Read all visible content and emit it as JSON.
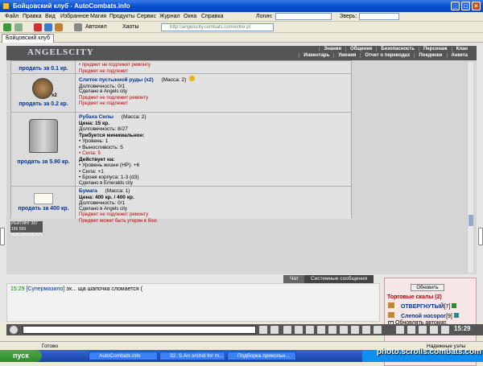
{
  "window": {
    "title": "Бойцовский клуб - AutoCombats.info"
  },
  "menu": [
    "Файл",
    "Правка",
    "Вид",
    "Избранное",
    "Магия",
    "Продукты",
    "Сервис",
    "Журнал",
    "Окна",
    "Справка"
  ],
  "toolbar": {
    "login_label": "Логин:",
    "beast_label": "Зверь:",
    "autoheal": "Автохил",
    "chaos": "Хаоты",
    "address": "http://angelscity.combats.com/enter.pl"
  },
  "tab": {
    "label": "Бойцовский клуб"
  },
  "game": {
    "logo": "ANGELSCITY",
    "nav_top": [
      "Знания",
      "Общение",
      "Безопасность",
      "Персонаж",
      "Клан"
    ],
    "nav_bottom": [
      "Инвентарь",
      "Умения",
      "Отчет о переводах",
      "Поединки",
      "Анкета"
    ]
  },
  "items": [
    {
      "sell": "продать за 0.1 кр.",
      "lines_red": [
        "• предмет не подлежит ремонту",
        "Предмет не подлежит"
      ]
    },
    {
      "name": "Слиток пустынной руды (x2)",
      "mass": "(Масса: 2)",
      "durability": "Долговечность: 0/1",
      "made": "Сделано в Angels city",
      "red": [
        "Предмет не подлежит ремонту",
        "Предмет не подлежит"
      ],
      "count": "x2",
      "sell": "продать за 0.2 кр."
    },
    {
      "name": "Рубаха Силы",
      "mass": "(Масса: 2)",
      "price": "Цена: 15 кр.",
      "durability": "Долговечность: 8/27",
      "req_title": "Требуется минимальное:",
      "reqs": [
        "• Уровень: 1",
        "• Выносливость: 5"
      ],
      "req_red": "• Сила: 5",
      "effects_title": "Действует на:",
      "effects": [
        "• Уровень жизни (HP): +6",
        "• Сила: +1",
        "• Броня корпуса: 1-3 (d3)"
      ],
      "made": "Сделано в Emeralds city",
      "sell": "продать за 5.90 кр."
    },
    {
      "name": "Бумага",
      "mass": "(Масса: 1)",
      "price": "Цена: 400 кр. / 400 кр.",
      "durability": "Долговечность: 0/1",
      "made": "Сделано в Angels city",
      "red": [
        "Предмет не подлежит ремонту",
        "Предмет может быть утерян в бою"
      ],
      "sell": "продать за 400 кр."
    }
  ],
  "banner": {
    "line1": "РЕЙТИНГ 397 156 559",
    "line2": "mail 184 609 415",
    "line3": "39618"
  },
  "chat": {
    "tab_chat": "Чат",
    "tab_system": "Системные сообщения",
    "messages": [
      {
        "time": "15:29",
        "user": "[Супермазило]",
        "text": "эх... ща шапочка сломается ("
      }
    ]
  },
  "right": {
    "refresh": "Обновить",
    "title": "Торговые скалы (2)",
    "users": [
      {
        "name": "ОТВЕРГНУТЫЙ",
        "level": "[7]"
      },
      {
        "name": "Слепой носорог",
        "level": "[9]"
      }
    ],
    "auto": "Обновлять автомат."
  },
  "clock": "15:29",
  "status": {
    "left": "Готово",
    "right": "Надежные узлы"
  },
  "taskbar": {
    "start": "пуск",
    "tasks": [
      "AutoCombats.info",
      "32. S.An orchid for m...",
      "Подборка прикольн..."
    ]
  },
  "watermark": "photo.scrolls.combats.com"
}
